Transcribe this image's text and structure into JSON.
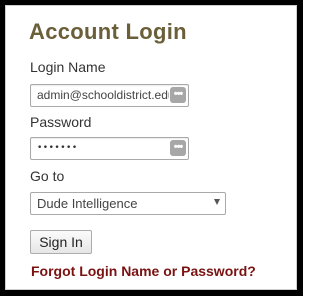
{
  "form": {
    "title": "Account Login",
    "login_name_label": "Login Name",
    "login_name_value": "admin@schooldistrict.edu",
    "password_label": "Password",
    "password_value": "•••••••",
    "goto_label": "Go to",
    "goto_selected": "Dude Intelligence",
    "signin_label": "Sign In",
    "forgot_link": "Forgot Login Name or Password?"
  },
  "icons": {
    "field_icon": "password-manager-icon",
    "select_icon": "chevron-down-icon"
  },
  "colors": {
    "title": "#6b5f3a",
    "link": "#7a1212",
    "frame": "#000000"
  }
}
